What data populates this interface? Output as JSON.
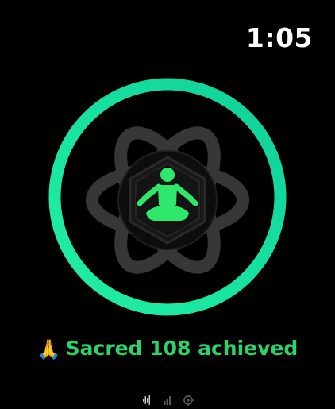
{
  "status_bar": {
    "time": "1:05"
  },
  "meditation": {
    "progress_fraction": 1.0,
    "ring_color_start": "#1fe69a",
    "ring_color_end": "#12d6a0",
    "ring_track_color": "#0a3a2a",
    "icon_color": "#2ee86b",
    "atom_color": "#3a3a3a",
    "icon": "meditation-person-icon"
  },
  "achievement": {
    "emoji": "🙏",
    "text": "Sacred 108 achieved",
    "color": "#2bd36b"
  },
  "page_indicators": {
    "items": [
      "waveform-icon",
      "bar-chart-icon",
      "settings-icon"
    ],
    "active_index": 0
  }
}
